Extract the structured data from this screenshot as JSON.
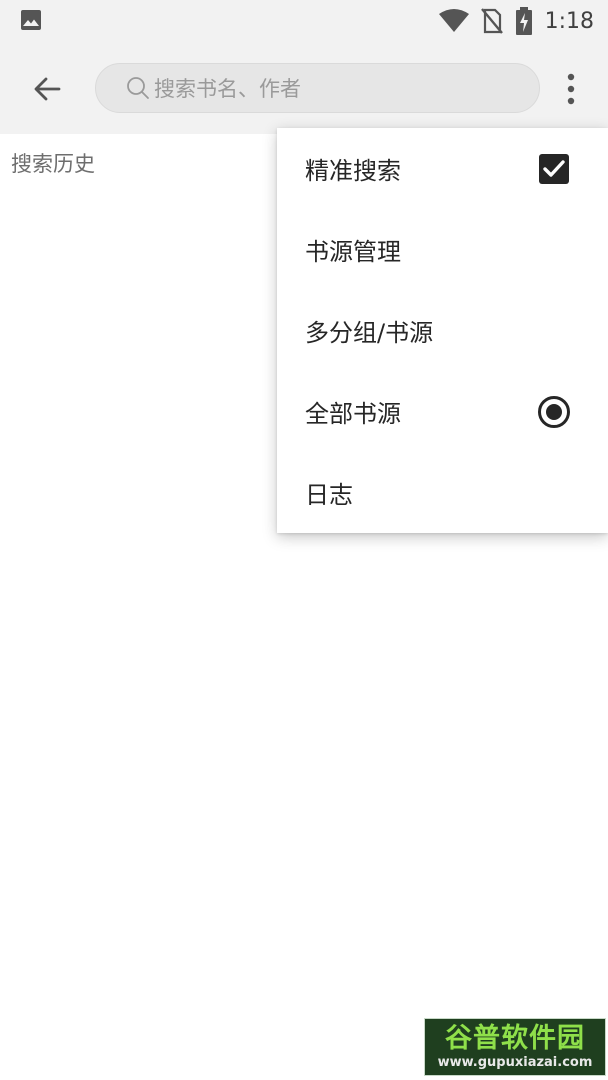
{
  "status_bar": {
    "time": "1:18",
    "icons": [
      "image-icon",
      "wifi-icon",
      "no-sim-icon",
      "battery-charging-icon"
    ]
  },
  "toolbar": {
    "back_icon": "arrow-left-icon",
    "search": {
      "placeholder": "搜索书名、作者",
      "value": ""
    },
    "more_icon": "more-vert-icon"
  },
  "content": {
    "history_label": "搜索历史"
  },
  "menu": {
    "items": [
      {
        "label": "精准搜索",
        "control": "checkbox",
        "checked": true
      },
      {
        "label": "书源管理"
      },
      {
        "label": "多分组/书源"
      },
      {
        "label": "全部书源",
        "control": "radio",
        "checked": true
      },
      {
        "label": "日志"
      }
    ]
  },
  "watermark": {
    "title": "谷普软件园",
    "url": "www.gupuxiazai.com"
  },
  "colors": {
    "bar_background": "#f2f2f2",
    "search_background": "#e6e6e6",
    "text_primary": "#262626",
    "text_secondary": "#6e6e6e",
    "placeholder": "#9a9a9a"
  }
}
